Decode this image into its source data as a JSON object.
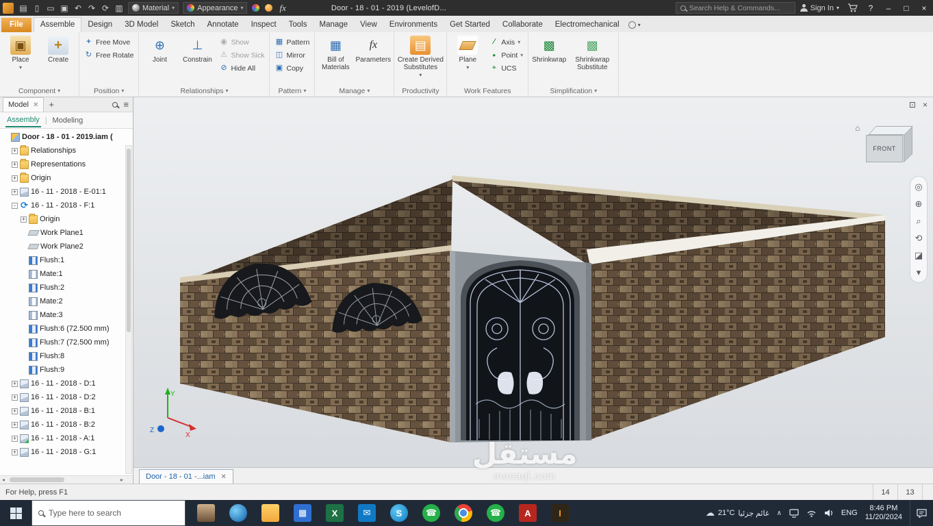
{
  "colors": {
    "accent": "#1b7fd4",
    "titlebar_bg": "#2e2e2e",
    "ribbon_bg": "#f3f3f3",
    "taskbar_bg": "#202a37",
    "brick_base": "#6e5a45",
    "door_color": "#12161a",
    "door_frame": "#8e959b",
    "assembly_tab_accent": "#1d8a72"
  },
  "titlebar": {
    "quick_access": [
      {
        "name": "app-menu-icon",
        "glyph": "▤"
      },
      {
        "name": "new-file-icon",
        "glyph": "▯"
      },
      {
        "name": "open-icon",
        "glyph": "▭"
      },
      {
        "name": "save-icon",
        "glyph": "▣"
      },
      {
        "name": "undo-icon",
        "glyph": "↶"
      },
      {
        "name": "redo-icon",
        "glyph": "↷"
      },
      {
        "name": "update-icon",
        "glyph": "⟳"
      },
      {
        "name": "select-filter-icon",
        "glyph": "▥"
      }
    ],
    "material_label": "Material",
    "appearance_label": "Appearance",
    "fx_label": "fx",
    "title": "Door - 18 - 01 - 2019 (LevelofD...",
    "search_placeholder": "Search Help & Commands...",
    "sign_in_label": "Sign In"
  },
  "ribbon": {
    "tabs": [
      {
        "label": "File",
        "file": true
      },
      {
        "label": "Assemble",
        "active": true
      },
      {
        "label": "Design"
      },
      {
        "label": "3D Model"
      },
      {
        "label": "Sketch"
      },
      {
        "label": "Annotate"
      },
      {
        "label": "Inspect"
      },
      {
        "label": "Tools"
      },
      {
        "label": "Manage"
      },
      {
        "label": "View"
      },
      {
        "label": "Environments"
      },
      {
        "label": "Get Started"
      },
      {
        "label": "Collaborate"
      },
      {
        "label": "Electromechanical"
      }
    ],
    "component": {
      "place": "Place",
      "create": "Create",
      "label": "Component"
    },
    "position": {
      "free_move": "Free Move",
      "free_rotate": "Free Rotate",
      "label": "Position"
    },
    "relationships": {
      "joint": "Joint",
      "constrain": "Constrain",
      "show": "Show",
      "show_sick": "Show Sick",
      "hide_all": "Hide All",
      "label": "Relationships"
    },
    "pattern": {
      "pattern": "Pattern",
      "mirror": "Mirror",
      "copy": "Copy",
      "label": "Pattern"
    },
    "manage": {
      "bom": "Bill of Materials",
      "parameters": "Parameters",
      "label": "Manage"
    },
    "productivity": {
      "cds": "Create Derived Substitutes",
      "label": "Productivity"
    },
    "work_features": {
      "plane": "Plane",
      "axis": "Axis",
      "point": "Point",
      "ucs": "UCS",
      "label": "Work Features"
    },
    "simplification": {
      "shrinkwrap": "Shrinkwrap",
      "shrinkwrap_substitute": "Shrinkwrap Substitute",
      "label": "Simplification"
    }
  },
  "browser": {
    "tab_label": "Model",
    "assembly_tab": "Assembly",
    "modeling_tab": "Modeling",
    "tree": [
      {
        "exp": "",
        "icon": "asm",
        "label": "Door - 18 - 01 - 2019.iam (",
        "indent": 0,
        "bold": true
      },
      {
        "exp": "+",
        "icon": "folder",
        "label": "Relationships",
        "indent": 1
      },
      {
        "exp": "+",
        "icon": "folder",
        "label": "Representations",
        "indent": 1
      },
      {
        "exp": "+",
        "icon": "folder",
        "label": "Origin",
        "indent": 1
      },
      {
        "exp": "+",
        "icon": "part",
        "label": "16 - 11 - 2018 - E-01:1",
        "indent": 1
      },
      {
        "exp": "-",
        "icon": "refresh",
        "label": "16 - 11 - 2018 - F:1",
        "indent": 1
      },
      {
        "exp": "+",
        "icon": "folder",
        "label": "Origin",
        "indent": 2
      },
      {
        "exp": "",
        "icon": "plane",
        "label": "Work Plane1",
        "indent": 2
      },
      {
        "exp": "",
        "icon": "plane",
        "label": "Work Plane2",
        "indent": 2
      },
      {
        "exp": "",
        "icon": "flush",
        "label": "Flush:1",
        "indent": 2
      },
      {
        "exp": "",
        "icon": "mate",
        "label": "Mate:1",
        "indent": 2
      },
      {
        "exp": "",
        "icon": "flush",
        "label": "Flush:2",
        "indent": 2
      },
      {
        "exp": "",
        "icon": "mate",
        "label": "Mate:2",
        "indent": 2
      },
      {
        "exp": "",
        "icon": "mate",
        "label": "Mate:3",
        "indent": 2
      },
      {
        "exp": "",
        "icon": "flush",
        "label": "Flush:6 (72.500 mm)",
        "indent": 2
      },
      {
        "exp": "",
        "icon": "flush",
        "label": "Flush:7 (72.500 mm)",
        "indent": 2
      },
      {
        "exp": "",
        "icon": "flush",
        "label": "Flush:8",
        "indent": 2
      },
      {
        "exp": "",
        "icon": "flush",
        "label": "Flush:9",
        "indent": 2
      },
      {
        "exp": "+",
        "icon": "part",
        "label": "16 - 11 - 2018 - D:1",
        "indent": 1
      },
      {
        "exp": "+",
        "icon": "part",
        "label": "16 - 11 - 2018 - D:2",
        "indent": 1
      },
      {
        "exp": "+",
        "icon": "part",
        "label": "16 - 11 - 2018 - B:1",
        "indent": 1
      },
      {
        "exp": "+",
        "icon": "part",
        "label": "16 - 11 - 2018 - B:2",
        "indent": 1
      },
      {
        "exp": "+",
        "icon": "sketchpart",
        "label": "16 - 11 - 2018 - A:1",
        "indent": 1
      },
      {
        "exp": "+",
        "icon": "part",
        "label": "16 - 11 - 2018 - G:1",
        "indent": 1
      }
    ]
  },
  "viewport": {
    "viewcube_label": "FRONT",
    "axis_x": "X",
    "axis_y": "Y",
    "axis_z": "Z",
    "watermark_title": "مستقل",
    "watermark_sub": "mosaql.com",
    "nav_tools": [
      {
        "name": "navigation-wheel-icon",
        "glyph": "◎"
      },
      {
        "name": "pan-icon",
        "glyph": "⊕"
      },
      {
        "name": "zoom-icon",
        "glyph": "⌕"
      },
      {
        "name": "orbit-icon",
        "glyph": "⟲"
      },
      {
        "name": "look-at-icon",
        "glyph": "◪"
      },
      {
        "name": "more-nav-tools-icon",
        "glyph": "▾"
      }
    ]
  },
  "doc_tab": {
    "label": "Door - 18 - 01 -...iam"
  },
  "statusbar": {
    "help_text": "For Help, press F1",
    "value_a": "14",
    "value_b": "13"
  },
  "taskbar": {
    "search_placeholder": "Type here to search",
    "icons": [
      {
        "name": "taskbar-avatar",
        "glyph": "",
        "bg": "linear-gradient(180deg,#cdb08c,#6d5138)",
        "fg": "#fff"
      },
      {
        "name": "edge-browser-icon",
        "glyph": "",
        "bg": "radial-gradient(circle at 35% 35%, #7cd0f6, #0d5ea8)",
        "round": true
      },
      {
        "name": "file-explorer-icon",
        "glyph": "",
        "bg": "linear-gradient(#ffd069,#f0a93c)"
      },
      {
        "name": "calculator-icon",
        "glyph": "▦",
        "bg": "#2f6fd0",
        "fg": "#ffffff"
      },
      {
        "name": "excel-icon",
        "glyph": "X",
        "bg": "#1e7145",
        "fg": "#ffffff"
      },
      {
        "name": "mail-icon",
        "glyph": "✉",
        "bg": "#1179c4",
        "fg": "#ffffff"
      },
      {
        "name": "skype-icon",
        "glyph": "S",
        "bg": "radial-gradient(circle at 35% 35%, #5ec6f2, #0f7cc4)",
        "fg": "#ffffff",
        "round": true
      },
      {
        "name": "whatsapp-icon",
        "glyph": "☎",
        "bg": "#25b04a",
        "fg": "#ffffff",
        "round": true
      },
      {
        "name": "chrome-icon",
        "glyph": "",
        "bg": "radial-gradient(circle, #4a90e2 0 5px, #fff 5px 7px, rgba(0,0,0,0) 7px), conic-gradient(from -45deg, #ea4335 0 120deg, #fbbc05 120deg 240deg, #34a853 240deg 360deg)",
        "round": true
      },
      {
        "name": "whatsapp-icon-2",
        "glyph": "☎",
        "bg": "#25b04a",
        "fg": "#ffffff",
        "round": true
      },
      {
        "name": "acrobat-icon",
        "glyph": "A",
        "bg": "#b8271f",
        "fg": "#ffffff"
      },
      {
        "name": "illustrator-icon",
        "glyph": "I",
        "bg": "#2f2617",
        "fg": "#f49b33"
      }
    ],
    "tray": {
      "temp": "21°C",
      "desc": "غائم جزئيا",
      "lang": "ENG",
      "time": "8:46 PM",
      "date": "11/20/2024"
    }
  }
}
